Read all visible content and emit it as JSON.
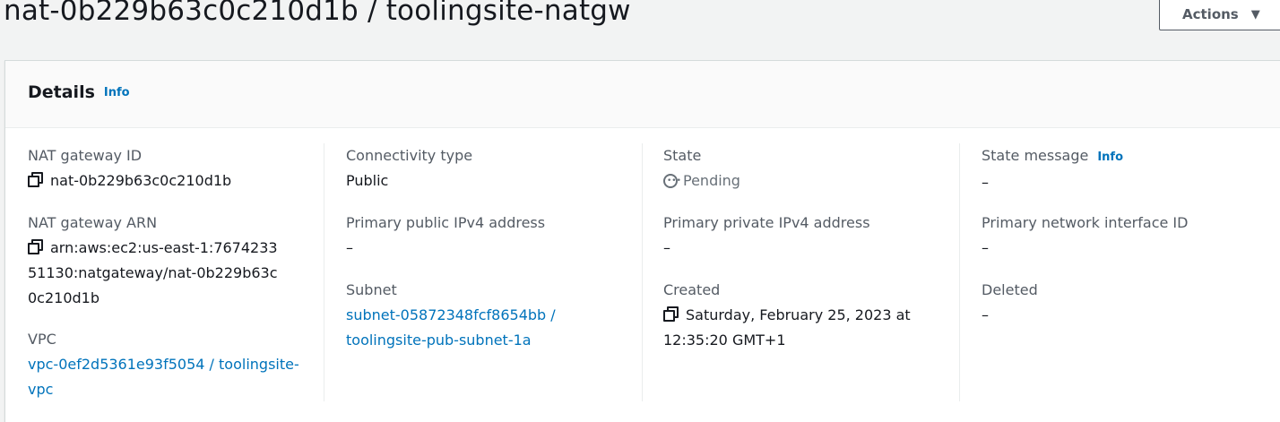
{
  "header": {
    "title": "nat-0b229b63c0c210d1b / toolingsite-natgw",
    "actions_label": "Actions",
    "actions_icon": "caret-down-icon"
  },
  "details": {
    "heading": "Details",
    "info_label": "Info",
    "columns": [
      {
        "fields": [
          {
            "label": "NAT gateway ID",
            "value": "nat-0b229b63c0c210d1b",
            "copyable": true
          },
          {
            "label": "NAT gateway ARN",
            "value": "arn:aws:ec2:us-east-1:767423351130:natgateway/nat-0b229b63c0c210d1b",
            "copyable": true
          },
          {
            "label": "VPC",
            "value": "vpc-0ef2d5361e93f5054 / toolingsite-vpc",
            "link": true
          }
        ]
      },
      {
        "fields": [
          {
            "label": "Connectivity type",
            "value": "Public"
          },
          {
            "label": "Primary public IPv4 address",
            "value": "–"
          },
          {
            "label": "Subnet",
            "value": "subnet-05872348fcf8654bb / toolingsite-pub-subnet-1a",
            "link": true
          }
        ]
      },
      {
        "fields": [
          {
            "label": "State",
            "value": "Pending",
            "status_icon": "pending-icon"
          },
          {
            "label": "Primary private IPv4 address",
            "value": "–"
          },
          {
            "label": "Created",
            "value": "Saturday, February 25, 2023 at 12:35:20 GMT+1",
            "copyable": true
          }
        ]
      },
      {
        "fields": [
          {
            "label": "State message",
            "value": "–",
            "info_label": "Info"
          },
          {
            "label": "Primary network interface ID",
            "value": "–"
          },
          {
            "label": "Deleted",
            "value": "–"
          }
        ]
      }
    ]
  }
}
